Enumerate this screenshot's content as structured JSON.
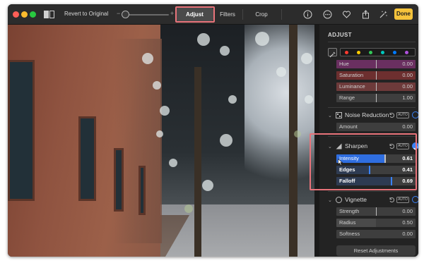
{
  "toolbar": {
    "revert_label": "Revert to Original",
    "zoom_minus": "−",
    "zoom_plus": "+",
    "tabs": [
      {
        "label": "Adjust",
        "active": true
      },
      {
        "label": "Filters",
        "active": false
      },
      {
        "label": "Crop",
        "active": false
      }
    ],
    "icons": [
      "info-icon",
      "more-icon",
      "favorite-heart-icon",
      "share-icon",
      "auto-enhance-icon"
    ],
    "done_label": "Done",
    "done_color": "#f5c33b"
  },
  "panel": {
    "title": "ADJUST",
    "swatch_colors": [
      "#ff3b30",
      "#ffcc00",
      "#34c759",
      "#00c7be",
      "#007aff",
      "#af52de"
    ],
    "color_sliders": [
      {
        "label": "Hue",
        "value": "0.00",
        "fill_color": "#6a2f60"
      },
      {
        "label": "Saturation",
        "value": "0.00",
        "fill_color": "#6d2f2f"
      },
      {
        "label": "Luminance",
        "value": "0.00",
        "fill_color": "#6d3a3a"
      },
      {
        "label": "Range",
        "value": "1.00",
        "fill_color": "#3e3e3e"
      }
    ],
    "noise_reduction": {
      "label": "Noise Reduction",
      "auto_label": "AUTO",
      "enabled": false,
      "sliders": [
        {
          "label": "Amount",
          "value": "0.00"
        }
      ]
    },
    "sharpen": {
      "label": "Sharpen",
      "auto_label": "AUTO",
      "enabled": true,
      "sliders": [
        {
          "label": "Intensity",
          "value": "0.61",
          "level": 0.61
        },
        {
          "label": "Edges",
          "value": "0.41",
          "level": 0.41
        },
        {
          "label": "Falloff",
          "value": "0.69",
          "level": 0.69
        }
      ]
    },
    "vignette": {
      "label": "Vignette",
      "auto_label": "AUTO",
      "enabled": false,
      "sliders": [
        {
          "label": "Strength",
          "value": "0.00"
        },
        {
          "label": "Radius",
          "value": "0.50"
        },
        {
          "label": "Softness",
          "value": "0.00"
        }
      ]
    },
    "reset_label": "Reset Adjustments"
  },
  "colors": {
    "accent": "#3a82f7",
    "highlight": "#e8737a"
  }
}
